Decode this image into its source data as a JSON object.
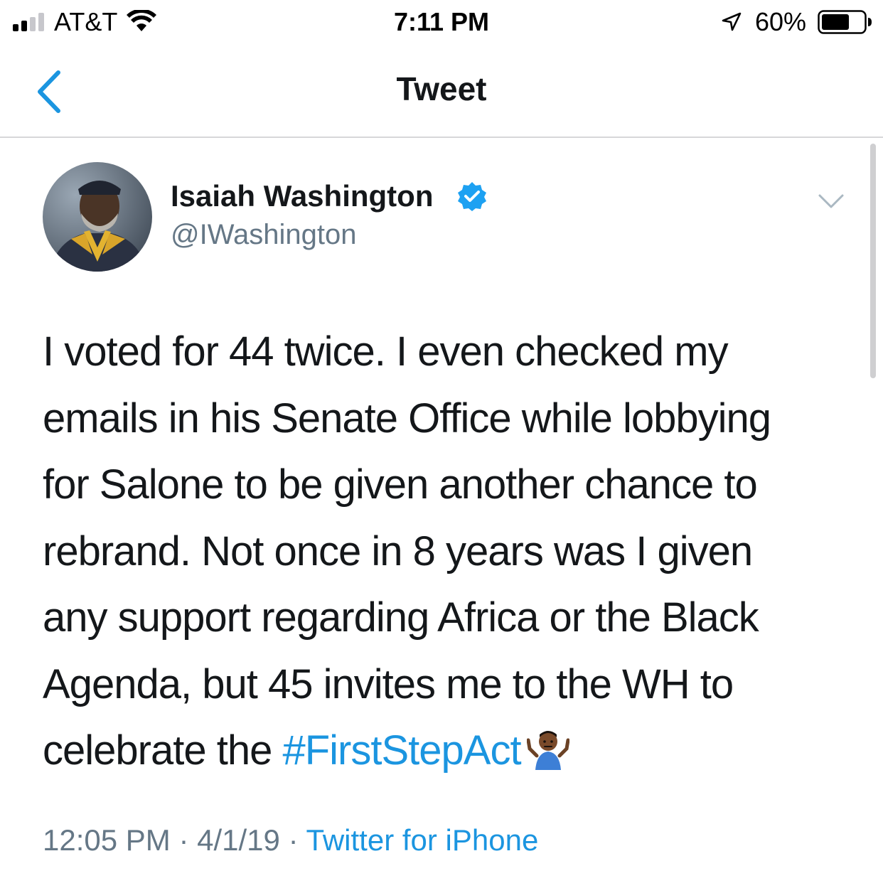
{
  "status_bar": {
    "carrier": "AT&T",
    "time": "7:11 PM",
    "battery_percent": "60%",
    "icons": [
      "signal-icon",
      "wifi-icon",
      "location-arrow-icon",
      "battery-icon"
    ]
  },
  "nav": {
    "title": "Tweet",
    "back_icon": "chevron-left-icon"
  },
  "tweet": {
    "author": {
      "display_name": "Isaiah Washington",
      "handle": "@IWashington",
      "verified": true
    },
    "text_lines": [
      "I voted for 44 twice. I even checked my",
      "emails in his Senate Office while lobbying",
      "for Salone to be given another chance to",
      "rebrand. Not once in 8 years was I given",
      "any support regarding Africa or the Black",
      "Agenda, but 45 invites me to the WH to"
    ],
    "last_line_prefix": "celebrate the ",
    "hashtag": "#FirstStepAct",
    "emoji": "person-shrugging-emoji",
    "time": "12:05 PM",
    "separator": "·",
    "date": "4/1/19",
    "source": "Twitter for iPhone"
  },
  "colors": {
    "accent": "#1b95e0",
    "text_primary": "#14171a",
    "text_secondary": "#657786",
    "verified_badge": "#1da1f2"
  }
}
